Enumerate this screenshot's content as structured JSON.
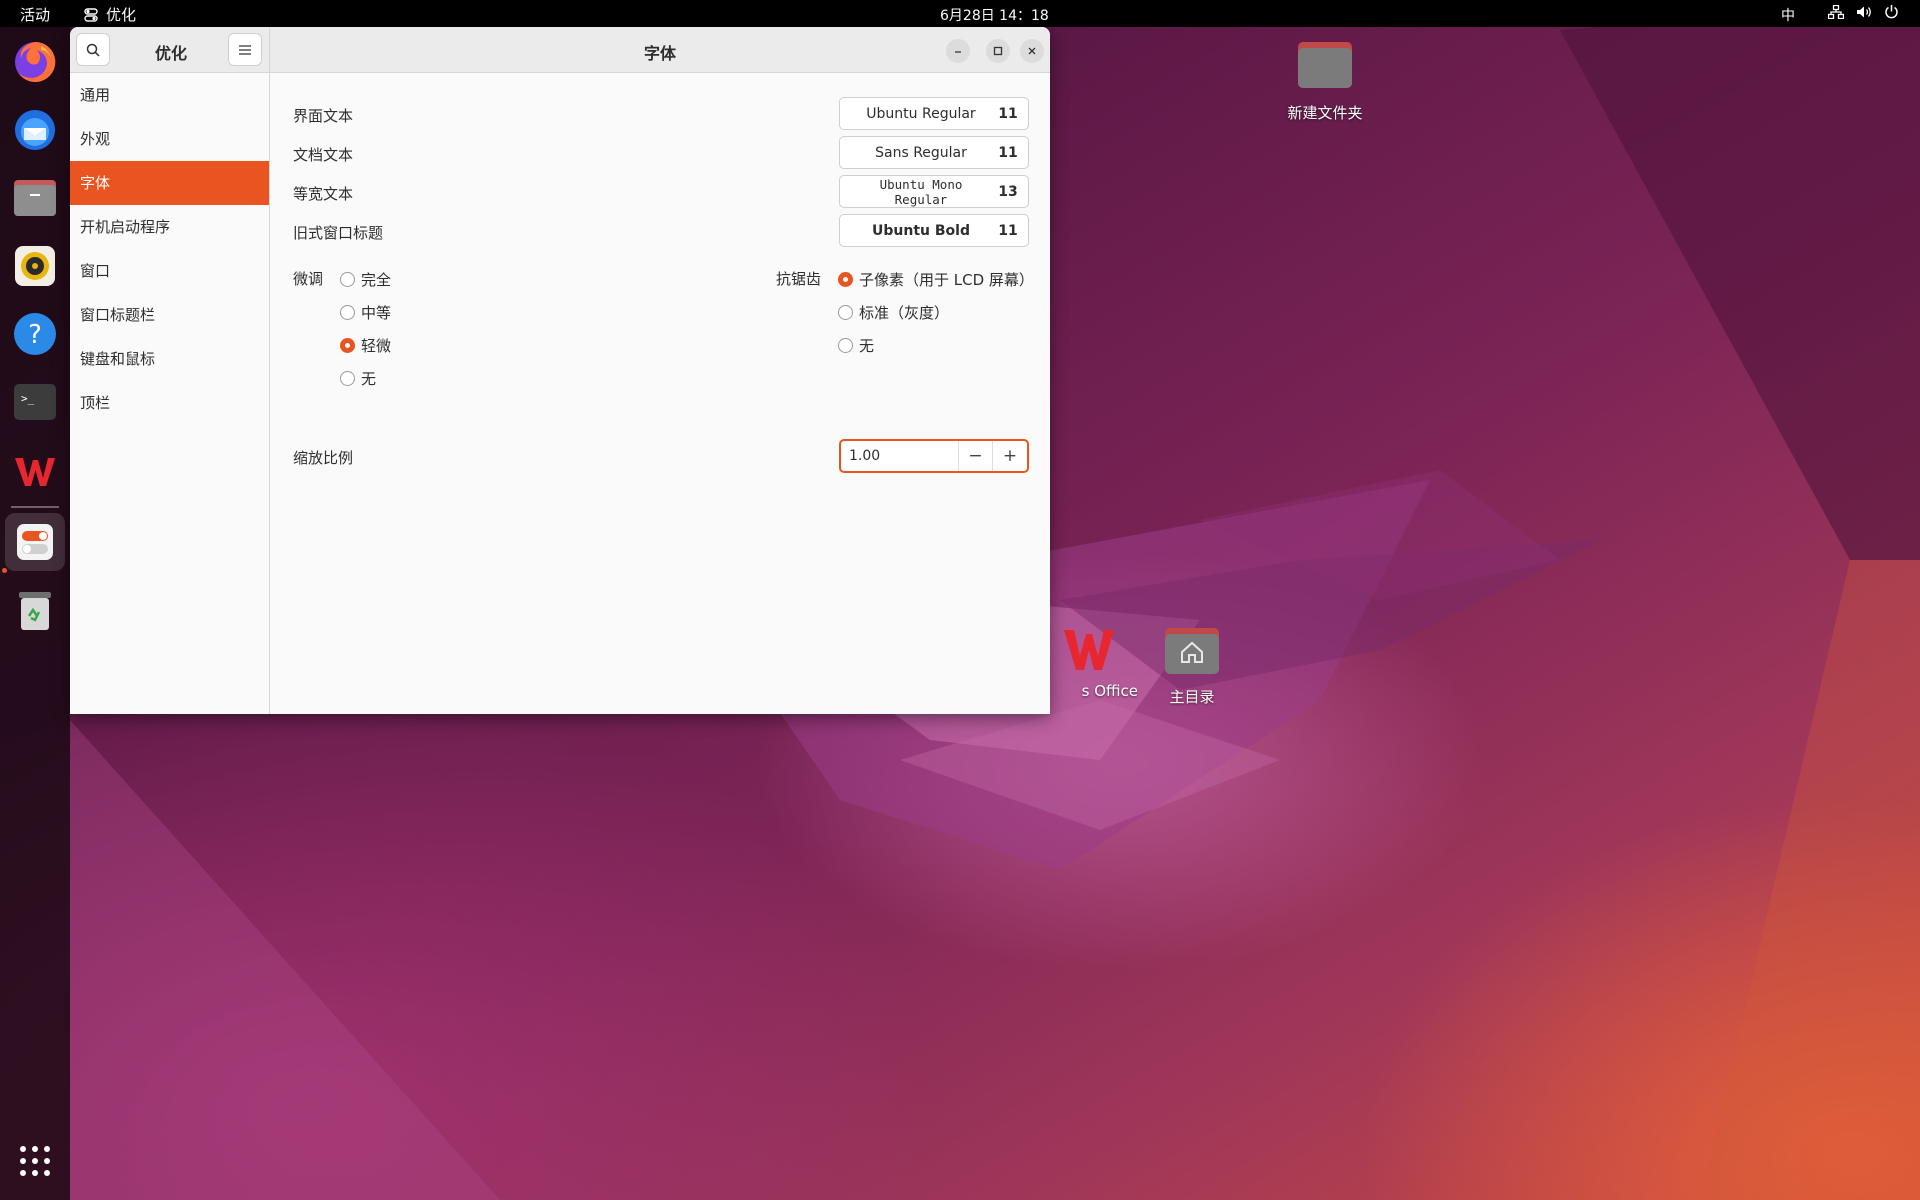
{
  "topbar": {
    "activities": "活动",
    "app_name": "优化",
    "clock": "6月28日 14：18",
    "input_method": "中"
  },
  "dock": {
    "items": [
      "firefox-icon",
      "thunderbird-icon",
      "files-icon",
      "rhythmbox-icon",
      "help-icon",
      "terminal-icon",
      "wps-office-icon",
      "tweaks-icon",
      "trash-icon",
      "show-apps-icon"
    ]
  },
  "desktop": {
    "new_folder": "新建文件夹",
    "wps_label": "s Office",
    "home": "主目录"
  },
  "window": {
    "sidebar_title": "优化",
    "title": "字体",
    "sidebar_items": [
      {
        "label": "通用"
      },
      {
        "label": "外观"
      },
      {
        "label": "字体"
      },
      {
        "label": "开机启动程序"
      },
      {
        "label": "窗口"
      },
      {
        "label": "窗口标题栏"
      },
      {
        "label": "键盘和鼠标"
      },
      {
        "label": "顶栏"
      }
    ],
    "selected_index": 2,
    "fonts": [
      {
        "label": "界面文本",
        "font": "Ubuntu Regular",
        "size": "11"
      },
      {
        "label": "文档文本",
        "font": "Sans Regular",
        "size": "11"
      },
      {
        "label": "等宽文本",
        "font": "Ubuntu Mono Regular",
        "size": "13"
      },
      {
        "label": "旧式窗口标题",
        "font": "Ubuntu Bold",
        "size": "11"
      }
    ],
    "hinting": {
      "label": "微调",
      "options": [
        "完全",
        "中等",
        "轻微",
        "无"
      ],
      "selected": "轻微"
    },
    "antialiasing": {
      "label": "抗锯齿",
      "options": [
        "子像素（用于 LCD 屏幕）",
        "标准（灰度）",
        "无"
      ],
      "selected": "子像素（用于 LCD 屏幕）"
    },
    "scaling": {
      "label": "缩放比例",
      "value": "1.00"
    }
  },
  "colors": {
    "accent": "#e95420"
  }
}
